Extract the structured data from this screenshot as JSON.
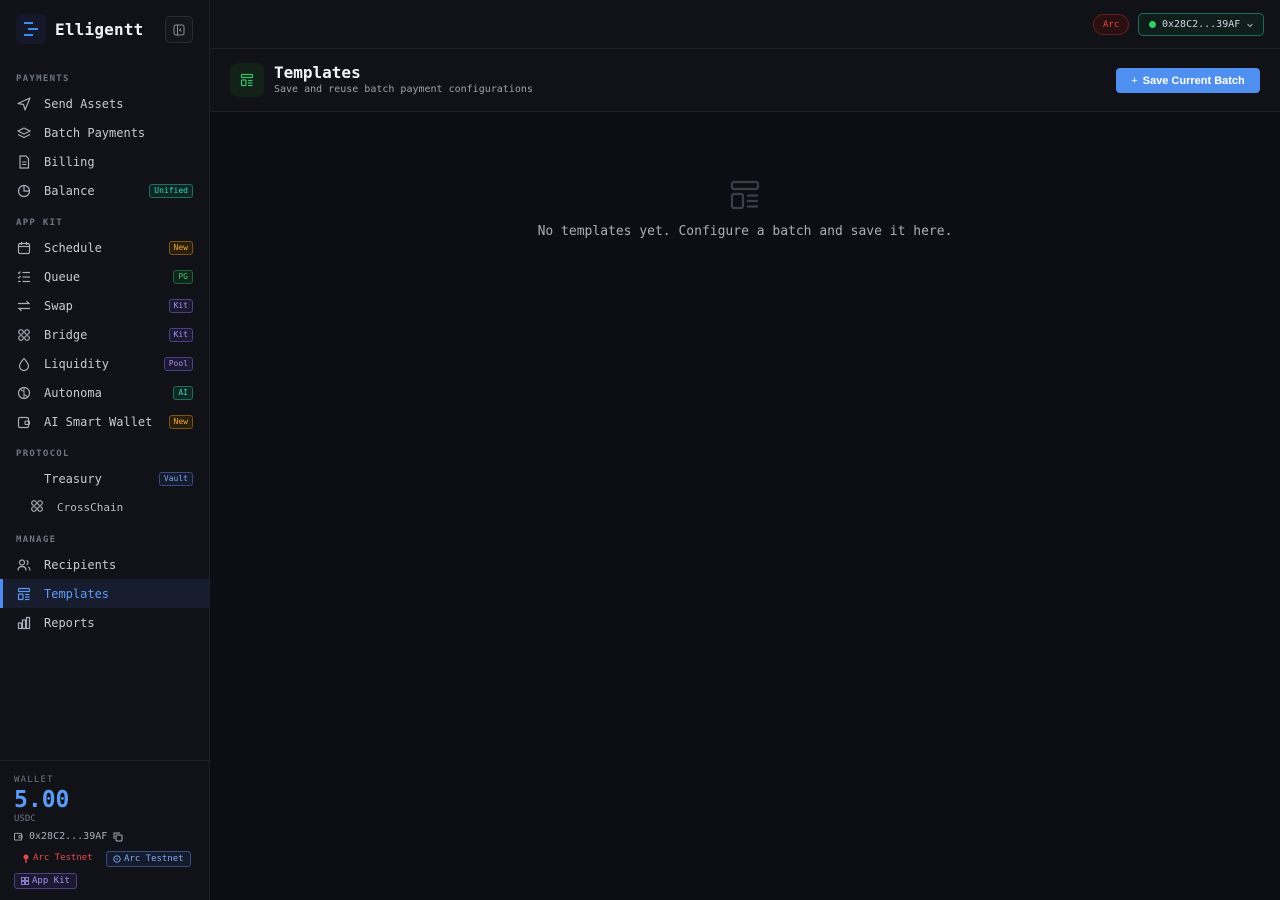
{
  "brand": {
    "name": "Elligentt"
  },
  "sidebar": {
    "sections": {
      "payments": "PAYMENTS",
      "app_kit": "APP KIT",
      "protocol": "PROTOCOL",
      "manage": "MANAGE"
    },
    "items": {
      "send_assets": {
        "label": "Send Assets",
        "icon": "send-icon"
      },
      "batch_payments": {
        "label": "Batch Payments",
        "icon": "layers-icon"
      },
      "billing": {
        "label": "Billing",
        "icon": "document-icon"
      },
      "balance": {
        "label": "Balance",
        "icon": "chart-pie-icon",
        "badge": "Unified"
      },
      "schedule": {
        "label": "Schedule",
        "icon": "calendar-icon",
        "badge": "New"
      },
      "queue": {
        "label": "Queue",
        "icon": "list-check-icon",
        "badge": "PG"
      },
      "swap": {
        "label": "Swap",
        "icon": "swap-arrows-icon",
        "badge": "Kit"
      },
      "bridge": {
        "label": "Bridge",
        "icon": "bridge-icon",
        "badge": "Kit"
      },
      "liquidity": {
        "label": "Liquidity",
        "icon": "droplet-icon",
        "badge": "Pool"
      },
      "autonoma": {
        "label": "Autonoma",
        "icon": "brain-icon",
        "badge": "AI"
      },
      "ai_wallet": {
        "label": "AI Smart Wallet",
        "icon": "wallet-icon",
        "badge": "New"
      },
      "treasury": {
        "label": "Treasury",
        "badge": "Vault"
      },
      "crosschain": {
        "label": "CrossChain",
        "icon": "crosschain-icon"
      },
      "recipients": {
        "label": "Recipients",
        "icon": "users-icon"
      },
      "templates": {
        "label": "Templates",
        "icon": "template-icon",
        "active": true
      },
      "reports": {
        "label": "Reports",
        "icon": "bar-chart-icon"
      }
    }
  },
  "wallet": {
    "label": "WALLET",
    "balance": "5.00",
    "unit": "USDC",
    "address": "0x28C2...39AF",
    "network": "Arc Testnet",
    "network_chip": "Arc Testnet",
    "kit_chip": "App Kit"
  },
  "topbar": {
    "network_badge": "Arc",
    "wallet_address": "0x28C2...39AF"
  },
  "page": {
    "title": "Templates",
    "subtitle": "Save and reuse batch payment configurations",
    "save_button": "Save Current Batch",
    "empty_message": "No templates yet. Configure a batch and save it here."
  },
  "colors": {
    "accent": "#4f8ff0",
    "background": "#0d0e13",
    "sidebar": "#111217",
    "network_red": "#e5484d",
    "connected_green": "#2fcf6b"
  }
}
